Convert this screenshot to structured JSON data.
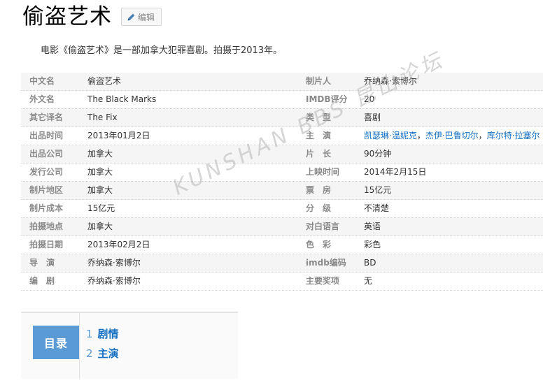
{
  "header": {
    "title": "偷盗艺术",
    "edit_label": "编辑"
  },
  "summary": "电影《偷盗艺术》是一部加拿大犯罪喜剧。拍摄于2013年。",
  "info": {
    "rows": [
      {
        "left_label": "中文名",
        "left_value": "偷盗艺术",
        "right_label": "制片人",
        "right_value": "乔纳森·索博尔"
      },
      {
        "left_label": "外文名",
        "left_value": "The Black Marks",
        "right_label": "IMDB评分",
        "right_value": "20"
      },
      {
        "left_label": "其它译名",
        "left_value": "The Fix",
        "right_label": "类　型",
        "right_value": "喜剧"
      },
      {
        "left_label": "出品时间",
        "left_value": "2013年01月2日",
        "right_label": "主　演",
        "right_value": ""
      },
      {
        "left_label": "出品公司",
        "left_value": "加拿大",
        "right_label": "片　长",
        "right_value": "90分钟"
      },
      {
        "left_label": "发行公司",
        "left_value": "加拿大",
        "right_label": "上映时间",
        "right_value": "2014年2月15日"
      },
      {
        "left_label": "制片地区",
        "left_value": "加拿大",
        "right_label": "票　房",
        "right_value": "15亿元"
      },
      {
        "left_label": "制片成本",
        "left_value": "15亿元",
        "right_label": "分　级",
        "right_value": "不清楚"
      },
      {
        "left_label": "拍摄地点",
        "left_value": "加拿大",
        "right_label": "对白语言",
        "right_value": "英语"
      },
      {
        "left_label": "拍摄日期",
        "left_value": "2013年02月2日",
        "right_label": "色　彩",
        "right_value": "彩色"
      },
      {
        "left_label": "导　演",
        "left_value": "乔纳森·索博尔",
        "right_label": "imdb编码",
        "right_value": "BD"
      },
      {
        "left_label": "编　剧",
        "left_value": "乔纳森·索博尔",
        "right_label": "主要奖项",
        "right_value": "无"
      }
    ],
    "cast_links": [
      "凯瑟琳·温妮克",
      "杰伊·巴鲁切尔",
      "库尔特·拉塞尔"
    ],
    "cast_separator": "，"
  },
  "watermark": "KUNSHAN BBS 昆山论坛",
  "toc": {
    "label": "目录",
    "items": [
      {
        "num": "1",
        "text": "剧情"
      },
      {
        "num": "2",
        "text": "主演"
      }
    ]
  },
  "colors": {
    "link": "#136ec2",
    "toc_accent": "#5b9bd5",
    "label_gray": "#8a8a8a",
    "stripe": "#f5f5f5"
  },
  "icons": {
    "edit": "pencil-icon"
  }
}
